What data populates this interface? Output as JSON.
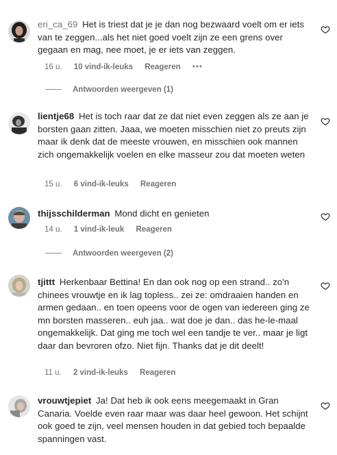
{
  "icons": {
    "like": "heart-outline-icon",
    "more": "more-horizontal-icon"
  },
  "comments": [
    {
      "username": "eri_ca_69",
      "text": "Het is triest dat je je dan nog bezwaard voelt om er iets van te zeggen...als het niet goed voelt zijn ze een grens over gegaan en mag, nee moet, je er iets van zeggen.",
      "time": "16 u.",
      "likes": "10 vind-ik-leuks",
      "reply": "Reageren",
      "more": "•••"
    },
    {
      "username": "lientje68",
      "text": "Het is toch raar dat ze dat niet even zeggen als ze aan je borsten gaan zitten. Jaaa, we moeten misschien niet zo preuts zijn maar ik denk dat de meeste vrouwen, en misschien ook mannen zich ongemakkelijk voelen en elke masseur zou dat moeten weten",
      "time": "15 u.",
      "likes": "6 vind-ik-leuks",
      "reply": "Reageren"
    },
    {
      "username": "thijsschilderman",
      "text": "Mond dicht en genieten",
      "time": "14 u.",
      "likes": "1 vind-ik-leuk",
      "reply": "Reageren"
    },
    {
      "username": "tjittt",
      "text": "Herkenbaar Bettina! En dan ook nog op een strand.. zo'n chinees vrouwtje en ik lag topless.. zei ze: omdraaien handen en armen gedaan.. en toen opeens voor de ogen van iedereen ging ze mn borsten masseren.. euh jaa.. wat doe je dan.. das he-le-maal ongemakkelijk. Dat ging me toch wel een tandje te ver.. maar je ligt daar dan bevroren ofzo. Niet fijn. Thanks dat je dit deelt!",
      "time": "11 u.",
      "likes": "2 vind-ik-leuks",
      "reply": "Reageren"
    },
    {
      "username": "vrouwtjepiet",
      "text": "Ja! Dat heb ik ook eens meegemaakt in Gran Canaria. Voelde even raar maar was daar heel gewoon. Het schijnt ook goed te zijn, veel mensen houden in dat gebied toch bepaalde spanningen vast."
    }
  ],
  "view_replies": [
    {
      "label": "Antwoorden weergeven (1)"
    },
    {
      "label": "Antwoorden weergeven (2)"
    }
  ]
}
